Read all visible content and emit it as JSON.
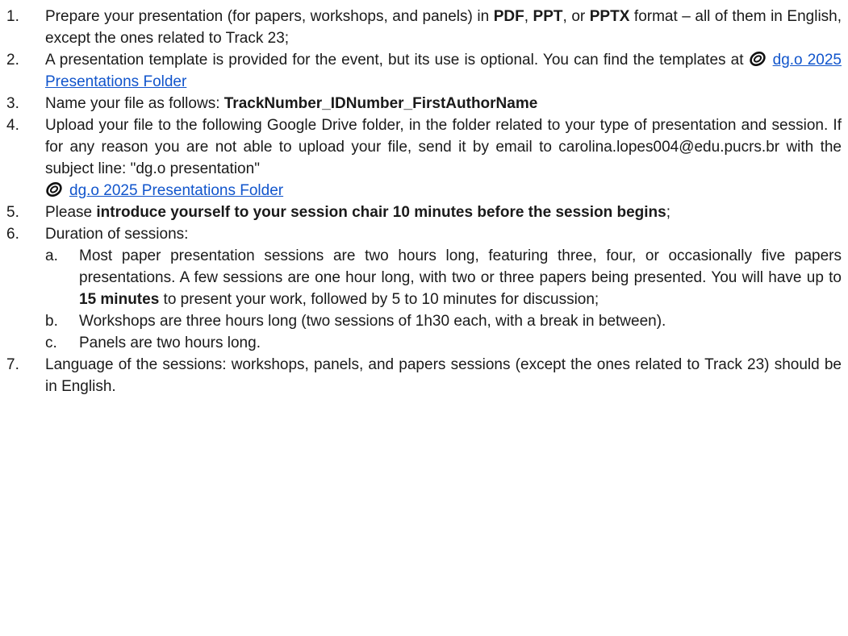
{
  "items": [
    {
      "num": "1.",
      "t1": "Prepare your presentation (for papers, workshops, and panels) in ",
      "b1": "PDF",
      "t2": ", ",
      "b2": "PPT",
      "t3": ", or ",
      "b3": "PPTX",
      "t4": " format – all of them in English, except the ones related to Track 23;"
    },
    {
      "num": "2.",
      "t1": "A presentation template is provided for the event, but its use is optional. You can find the templates at ",
      "link": "dg.o 2025 Presentations Folder"
    },
    {
      "num": "3.",
      "t1": "Name your file as follows: ",
      "b1": "TrackNumber_IDNumber_FirstAuthorName"
    },
    {
      "num": "4.",
      "t1": "Upload your file to the following Google Drive folder, in the folder related to your type of presentation and session. If for any reason you are not able to upload your file, send it by email to carolina.lopes004@edu.pucrs.br with the subject line: \"dg.o presentation\"",
      "link": "dg.o 2025 Presentations Folder"
    },
    {
      "num": "5.",
      "t1": "Please ",
      "b1": "introduce yourself to your session chair 10 minutes before the session begins",
      "t2": ";"
    },
    {
      "num": "6.",
      "t1": "Duration of sessions:",
      "sub": [
        {
          "num": "a.",
          "t1": "Most paper presentation sessions are two hours long, featuring three, four, or occasionally five papers presentations. A few sessions are one hour long, with two or three papers being presented. You will have up to ",
          "b1": "15 minutes",
          "t2": " to present your work, followed by 5 to 10 minutes for discussion;"
        },
        {
          "num": "b.",
          "t1": "Workshops are three hours long (two sessions of 1h30 each, with a break in between)."
        },
        {
          "num": "c.",
          "t1": "Panels are two hours long."
        }
      ]
    },
    {
      "num": "7.",
      "t1": "Language of the sessions: workshops, panels, and papers sessions (except the ones related to Track 23) should be in English."
    }
  ],
  "colors": {
    "link": "#1155cc",
    "text": "#1a1a1a"
  },
  "icons": {
    "link_icon": "paperclip-icon"
  }
}
